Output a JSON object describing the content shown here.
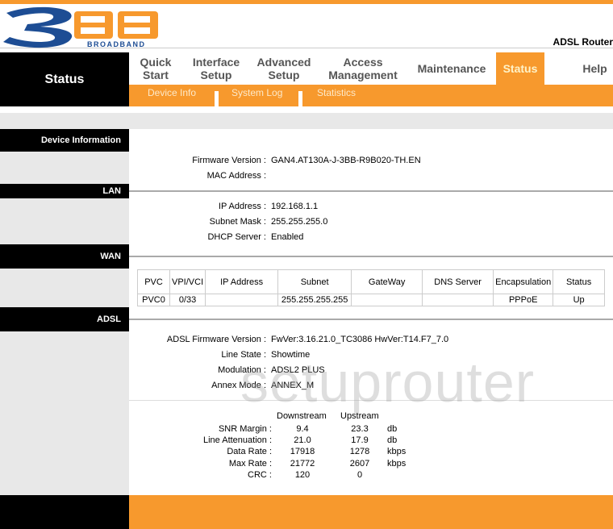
{
  "brand": {
    "logo_big": "3BB",
    "logo_small": "BROADBAND",
    "product": "ADSL Router"
  },
  "nav": {
    "section_title": "Status",
    "items": [
      {
        "label": "Quick Start"
      },
      {
        "label": "Interface Setup"
      },
      {
        "label": "Advanced Setup"
      },
      {
        "label": "Access Management"
      },
      {
        "label": "Maintenance"
      },
      {
        "label": "Status",
        "active": true
      },
      {
        "label": "Help"
      }
    ],
    "subitems": [
      {
        "label": "Device Info"
      },
      {
        "label": "System Log"
      },
      {
        "label": "Statistics"
      }
    ]
  },
  "sections": {
    "device": "Device Information",
    "lan": "LAN",
    "wan": "WAN",
    "adsl": "ADSL"
  },
  "device": {
    "firmware_label": "Firmware Version :",
    "firmware": "GAN4.AT130A-J-3BB-R9B020-TH.EN",
    "mac_label": "MAC Address :",
    "mac": ""
  },
  "lan": {
    "ip_label": "IP Address :",
    "ip": "192.168.1.1",
    "mask_label": "Subnet Mask :",
    "mask": "255.255.255.0",
    "dhcp_label": "DHCP Server :",
    "dhcp": "Enabled"
  },
  "wan": {
    "headers": [
      "PVC",
      "VPI/VCI",
      "IP Address",
      "Subnet",
      "GateWay",
      "DNS Server",
      "Encapsulation",
      "Status"
    ],
    "rows": [
      [
        "PVC0",
        "0/33",
        "",
        "255.255.255.255",
        "",
        "",
        "PPPoE",
        "Up"
      ]
    ]
  },
  "adsl": {
    "fw_label": "ADSL Firmware Version :",
    "fw": "FwVer:3.16.21.0_TC3086 HwVer:T14.F7_7.0",
    "state_label": "Line State :",
    "state": "Showtime",
    "mod_label": "Modulation :",
    "mod": "ADSL2 PLUS",
    "annex_label": "Annex Mode :",
    "annex": "ANNEX_M",
    "stats": {
      "col_down": "Downstream",
      "col_up": "Upstream",
      "rows": [
        {
          "label": "SNR Margin :",
          "down": "9.4",
          "up": "23.3",
          "unit": "db"
        },
        {
          "label": "Line Attenuation :",
          "down": "21.0",
          "up": "17.9",
          "unit": "db"
        },
        {
          "label": "Data Rate :",
          "down": "17918",
          "up": "1278",
          "unit": "kbps"
        },
        {
          "label": "Max Rate :",
          "down": "21772",
          "up": "2607",
          "unit": "kbps"
        },
        {
          "label": "CRC :",
          "down": "120",
          "up": "0",
          "unit": ""
        }
      ]
    }
  },
  "watermark": "setuprouter"
}
